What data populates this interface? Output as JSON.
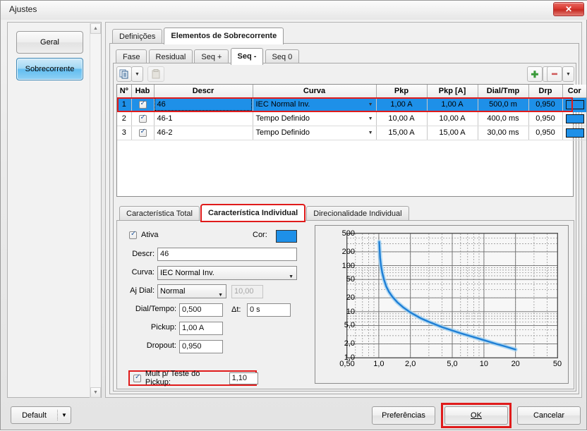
{
  "window": {
    "title": "Ajustes",
    "close_label": "✕",
    "close_icon": "close-icon"
  },
  "sidebar": {
    "items": [
      {
        "label": "Geral",
        "selected": false
      },
      {
        "label": "Sobrecorrente",
        "selected": true
      }
    ],
    "scroll_up_icon": "▲",
    "scroll_down_icon": "▼"
  },
  "tabs_level1": [
    {
      "label": "Definições",
      "active": false
    },
    {
      "label": "Elementos de Sobrecorrente",
      "active": true
    }
  ],
  "tabs_level2": [
    {
      "label": "Fase",
      "active": false
    },
    {
      "label": "Residual",
      "active": false
    },
    {
      "label": "Seq +",
      "active": false
    },
    {
      "label": "Seq -",
      "active": true
    },
    {
      "label": "Seq 0",
      "active": false
    }
  ],
  "toolbar": {
    "copy_icon": "copy-icon",
    "copy_caret": "▼",
    "paste_icon": "paste-icon",
    "add_icon": "✚",
    "add_caret": "▼",
    "remove_icon": "━",
    "remove_caret": "▼"
  },
  "grid": {
    "columns": [
      "Nº",
      "Hab",
      "Descr",
      "Curva",
      "Pkp",
      "Pkp [A]",
      "Dial/Tmp",
      "Drp",
      "Cor"
    ],
    "rows": [
      {
        "num": "1",
        "hab": true,
        "descr": "46",
        "curva": "IEC Normal Inv.",
        "pkp": "1,00 A",
        "pkpa": "1,00 A",
        "dial": "500,0 m",
        "drp": "0,950",
        "cor": "#1e90e8",
        "selected": true
      },
      {
        "num": "2",
        "hab": true,
        "descr": "46-1",
        "curva": "Tempo Definido",
        "pkp": "10,00 A",
        "pkpa": "10,00 A",
        "dial": "400,0 ms",
        "drp": "0,950",
        "cor": "#1e90e8",
        "selected": false
      },
      {
        "num": "3",
        "hab": true,
        "descr": "46-2",
        "curva": "Tempo Definido",
        "pkp": "15,00 A",
        "pkpa": "15,00 A",
        "dial": "30,00 ms",
        "drp": "0,950",
        "cor": "#1e90e8",
        "selected": false
      }
    ],
    "combo_caret": "▼"
  },
  "tabs_level3": [
    {
      "label": "Característica Total",
      "active": false
    },
    {
      "label": "Característica Individual",
      "active": true
    },
    {
      "label": "Direcionalidade Individual",
      "active": false
    }
  ],
  "form": {
    "ativa_label": "Ativa",
    "ativa_checked": true,
    "cor_label": "Cor:",
    "cor_value": "#1e90e8",
    "descr_label": "Descr:",
    "descr_value": "46",
    "curva_label": "Curva:",
    "curva_value": "IEC Normal Inv.",
    "ajdial_label": "Aj Dial:",
    "ajdial_value": "Normal",
    "ajdial_extra_value": "10,00",
    "dial_tempo_label": "Dial/Tempo:",
    "dial_tempo_value": "0,500",
    "delta_t_label": "Δt:",
    "delta_t_value": "0 s",
    "pickup_label": "Pickup:",
    "pickup_value": "1,00 A",
    "dropout_label": "Dropout:",
    "dropout_value": "0,950",
    "mult_label": "Mult p/ Teste do Pickup:",
    "mult_checked": true,
    "mult_value": "1,10",
    "caret": "▼"
  },
  "chart_data": {
    "type": "line",
    "title": "",
    "xlabel": "",
    "ylabel": "",
    "xscale": "log",
    "yscale": "log",
    "xlim": [
      0.5,
      50
    ],
    "ylim": [
      1.0,
      500
    ],
    "grid": true,
    "legend": false,
    "xticks": [
      "0,50",
      "1,0",
      "2,0",
      "5,0",
      "10",
      "20",
      "50"
    ],
    "xtick_values": [
      0.5,
      1.0,
      2.0,
      5.0,
      10,
      20,
      50
    ],
    "yticks": [
      "1,0",
      "2,0",
      "5,0",
      "10",
      "20",
      "50",
      "100",
      "200",
      "500"
    ],
    "ytick_values": [
      1.0,
      2.0,
      5.0,
      10,
      20,
      50,
      100,
      200,
      500
    ],
    "series": [
      {
        "name": "IEC Normal Inv.",
        "color": "#1e7fd6",
        "x": [
          1.01,
          1.03,
          1.05,
          1.08,
          1.12,
          1.18,
          1.25,
          1.35,
          1.5,
          1.7,
          2.0,
          2.5,
          3.0,
          4.0,
          5.0,
          6.0,
          8.0,
          10.0,
          13.0,
          16.0,
          20.0
        ],
        "y": [
          330.0,
          150.0,
          100.0,
          70.0,
          50.0,
          35.0,
          27.0,
          21.0,
          16.0,
          12.5,
          9.6,
          7.2,
          6.0,
          4.6,
          3.9,
          3.4,
          2.8,
          2.4,
          2.0,
          1.75,
          1.5
        ]
      }
    ]
  },
  "footer": {
    "default_label": "Default",
    "default_caret": "▼",
    "preferencias_label": "Preferências",
    "ok_label": "OK",
    "cancelar_label": "Cancelar"
  }
}
